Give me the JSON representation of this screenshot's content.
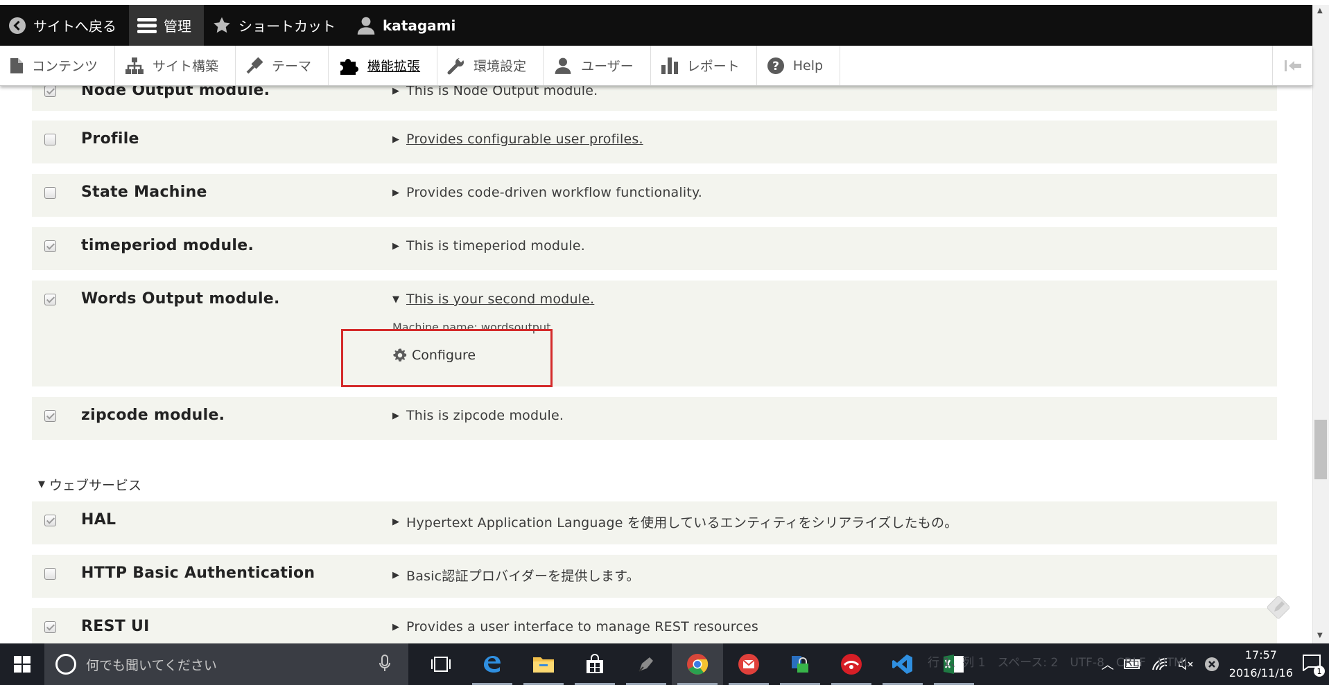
{
  "toolbar": {
    "back_to_site": "サイトへ戻る",
    "manage": "管理",
    "shortcuts": "ショートカット",
    "user": "katagami"
  },
  "tray": {
    "items": [
      {
        "label": "コンテンツ",
        "icon": "file-icon"
      },
      {
        "label": "サイト構築",
        "icon": "sitemap-icon"
      },
      {
        "label": "テーマ",
        "icon": "paintbrush-icon"
      },
      {
        "label": "機能拡張",
        "icon": "puzzle-icon",
        "active": true
      },
      {
        "label": "環境設定",
        "icon": "wrench-icon"
      },
      {
        "label": "ユーザー",
        "icon": "user-icon"
      },
      {
        "label": "レポート",
        "icon": "bar-chart-icon"
      },
      {
        "label": "Help",
        "icon": "help-icon"
      }
    ]
  },
  "modules": [
    {
      "name": "Node Output module.",
      "description": "This is Node Output module.",
      "checked": true,
      "link": false
    },
    {
      "name": "Profile",
      "description": "Provides configurable user profiles.",
      "checked": false,
      "link": true
    },
    {
      "name": "State Machine",
      "description": "Provides code-driven workflow functionality.",
      "checked": false,
      "link": false
    },
    {
      "name": "timeperiod module.",
      "description": "This is timeperiod module.",
      "checked": true,
      "link": false
    },
    {
      "name": "Words Output module.",
      "description": "This is your second module.",
      "checked": true,
      "link": true,
      "expanded": true,
      "machine_name": "Machine name: wordsoutput",
      "configure_label": "Configure"
    },
    {
      "name": "zipcode module.",
      "description": "This is zipcode module.",
      "checked": true,
      "link": false
    }
  ],
  "web_services": {
    "heading": "ウェブサービス",
    "modules": [
      {
        "name": "HAL",
        "description": "Hypertext Application Language を使用しているエンティティをシリアライズしたもの。",
        "checked": true
      },
      {
        "name": "HTTP Basic Authentication",
        "description": "Basic認証プロバイダーを提供します。",
        "checked": false
      },
      {
        "name": "REST UI",
        "description": "Provides a user interface to manage REST resources",
        "checked": true
      }
    ]
  },
  "taskbar": {
    "search_placeholder": "何でも聞いてください",
    "ghost_text": "行 1、列 1　スペース: 2　UTF-8　CRLF　HTML",
    "time": "17:57",
    "date": "2016/11/16",
    "notifications": "1"
  },
  "colors": {
    "toolbar_bg": "#0f0f0f",
    "row_bg": "#f3f4ee",
    "highlight": "#d42a2a",
    "taskbar_bg": "#1c1f26"
  }
}
